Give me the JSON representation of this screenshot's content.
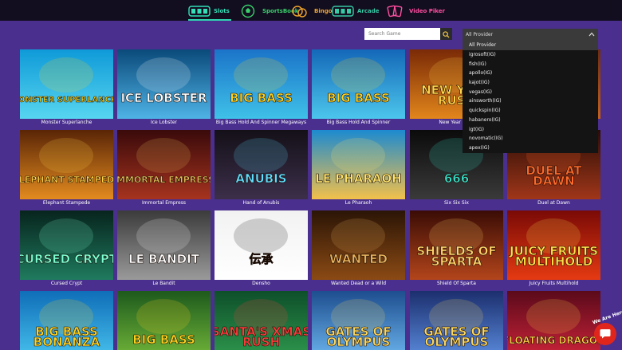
{
  "nav": {
    "items": [
      {
        "label": "Slots",
        "icon": "slot-machine-icon"
      },
      {
        "label": "SportsBook",
        "icon": "soccer-ball-icon"
      },
      {
        "label": "Bingo",
        "icon": "bingo-icon"
      },
      {
        "label": "Arcade",
        "icon": "arcade-icon"
      },
      {
        "label": "Video Piker",
        "icon": "cards-icon"
      }
    ],
    "active": "Slots"
  },
  "search": {
    "placeholder": "Search Game",
    "icon": "search-icon"
  },
  "provider": {
    "selected": "All Provider",
    "options": [
      "All Provider",
      "igrosoft(IG)",
      "fish(IG)",
      "apollo(IG)",
      "kajot(IG)",
      "vegas(IG)",
      "ainsworth(IG)",
      "quickspin(IG)",
      "habanero(IG)",
      "igt(IG)",
      "novomatic(IG)",
      "apex(IG)"
    ]
  },
  "games": [
    {
      "title": "Monster Superlanche",
      "art": "MONSTER SUPERLANCHE",
      "colors": [
        "#0f9ad8",
        "#57d6f0"
      ],
      "accent": "#f7d51d"
    },
    {
      "title": "Ice Lobster",
      "art": "ICE LOBSTER",
      "colors": [
        "#0a4a7a",
        "#4fb3e6"
      ],
      "accent": "#ffffff"
    },
    {
      "title": "Big Bass Hold And Spinner Megaways",
      "art": "BIG BASS",
      "colors": [
        "#1b74c9",
        "#3fc1e8"
      ],
      "accent": "#ffd21f"
    },
    {
      "title": "Big Bass Hold And Spinner",
      "art": "BIG BASS",
      "colors": [
        "#1468b8",
        "#4cc6ec"
      ],
      "accent": "#ffd21f"
    },
    {
      "title": "New Year Rush",
      "art": "NEW YEAR RUSH",
      "colors": [
        "#7a2a06",
        "#e2861c"
      ],
      "accent": "#ffd54a"
    },
    {
      "title": "",
      "art": "",
      "colors": [
        "#6b2c0f",
        "#c4611a"
      ],
      "accent": "#ffb347"
    },
    {
      "title": "Elephant Stampede",
      "art": "ELEPHANT STAMPEDE",
      "colors": [
        "#5a2506",
        "#e38b1f"
      ],
      "accent": "#ffd44a"
    },
    {
      "title": "Immortal Empress",
      "art": "IMMORTAL EMPRESS",
      "colors": [
        "#3a0a0a",
        "#a6331f"
      ],
      "accent": "#e9c35b"
    },
    {
      "title": "Hand of Anubis",
      "art": "ANUBIS",
      "colors": [
        "#141018",
        "#3c2f4a"
      ],
      "accent": "#5fe0ff"
    },
    {
      "title": "Le Pharaoh",
      "art": "LE PHARAOH",
      "colors": [
        "#1c8ad0",
        "#f3c04a"
      ],
      "accent": "#ffe36b"
    },
    {
      "title": "Six Six Six",
      "art": "666",
      "colors": [
        "#0b0b0b",
        "#3a3a3a"
      ],
      "accent": "#35e0c8"
    },
    {
      "title": "Duel at Dawn",
      "art": "DUEL AT DAWN",
      "colors": [
        "#2a0d05",
        "#a0361a"
      ],
      "accent": "#ff6a2a"
    },
    {
      "title": "Cursed Crypt",
      "art": "CURSED CRYPT",
      "colors": [
        "#07241d",
        "#1f7a5e"
      ],
      "accent": "#7dffd2"
    },
    {
      "title": "Le Bandit",
      "art": "LE BANDIT",
      "colors": [
        "#3b3b3b",
        "#9a9a9a"
      ],
      "accent": "#ffffff"
    },
    {
      "title": "Densho",
      "art": "伝承",
      "colors": [
        "#f2f2f2",
        "#ffffff"
      ],
      "accent": "#111111"
    },
    {
      "title": "Wanted Dead or a Wild",
      "art": "WANTED",
      "colors": [
        "#2b1506",
        "#8b4a14"
      ],
      "accent": "#e7b25c"
    },
    {
      "title": "Shield Of Sparta",
      "art": "SHIELDS OF SPARTA",
      "colors": [
        "#3a0c05",
        "#b3451b"
      ],
      "accent": "#ffd36a"
    },
    {
      "title": "Juicy Fruits Multihold",
      "art": "JUICY FRUITS MULTIHOLD",
      "colors": [
        "#7a0a06",
        "#e53a12"
      ],
      "accent": "#ffe14a"
    },
    {
      "title": "",
      "art": "BIG BASS BONANZA",
      "colors": [
        "#0f6eb8",
        "#49c4ef"
      ],
      "accent": "#ffd21f"
    },
    {
      "title": "",
      "art": "BIG BASS",
      "colors": [
        "#1d5a1d",
        "#74b83a"
      ],
      "accent": "#ffd21f"
    },
    {
      "title": "",
      "art": "SANTA'S XMAS RUSH",
      "colors": [
        "#0e4f2a",
        "#2f9a4e"
      ],
      "accent": "#ff3b3b"
    },
    {
      "title": "",
      "art": "GATES OF OLYMPUS",
      "colors": [
        "#1e4e8f",
        "#6db7ef"
      ],
      "accent": "#ffd75a"
    },
    {
      "title": "",
      "art": "GATES OF OLYMPUS",
      "colors": [
        "#1c2f6e",
        "#5c8ee0"
      ],
      "accent": "#ffd75a"
    },
    {
      "title": "",
      "art": "FLOATING DRAGON",
      "colors": [
        "#5a0a1a",
        "#d0243a"
      ],
      "accent": "#ffd04a"
    }
  ],
  "chat": {
    "tag": "We Are Here!",
    "icon": "chat-bubble-icon"
  }
}
